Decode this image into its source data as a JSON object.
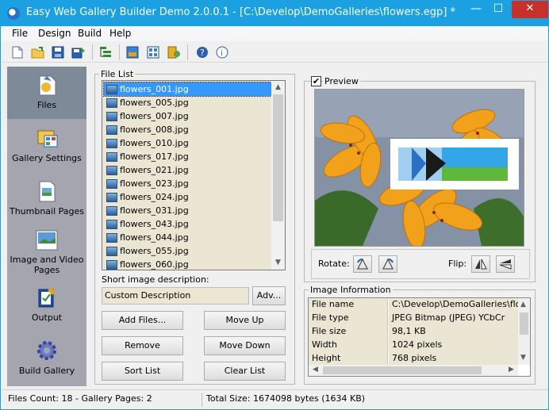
{
  "window": {
    "title": "Easy Web Gallery Builder Demo 2.0.0.1 - [C:\\Develop\\DemoGalleries\\flowers.egp] *"
  },
  "menu": [
    "File",
    "Design",
    "Build",
    "Help"
  ],
  "toolbar_icons": [
    "new-icon",
    "open-icon",
    "save-icon",
    "save-as-icon",
    "add-files-icon",
    "image-view-icon",
    "thumbnail-view-icon",
    "build-icon",
    "help-icon",
    "about-icon"
  ],
  "sidebar": {
    "items": [
      {
        "label": "Files",
        "icon": "files-icon",
        "active": true
      },
      {
        "label": "Gallery Settings",
        "icon": "gallery-settings-icon"
      },
      {
        "label": "Thumbnail Pages",
        "icon": "thumbnail-pages-icon"
      },
      {
        "label": "Image and Video Pages",
        "icon": "image-video-pages-icon"
      },
      {
        "label": "Output",
        "icon": "output-icon"
      },
      {
        "label": "Build Gallery",
        "icon": "build-gallery-icon"
      }
    ]
  },
  "file_list": {
    "label": "File List",
    "files": [
      "flowers_001.jpg",
      "flowers_005.jpg",
      "flowers_007.jpg",
      "flowers_008.jpg",
      "flowers_010.jpg",
      "flowers_017.jpg",
      "flowers_021.jpg",
      "flowers_023.jpg",
      "flowers_024.jpg",
      "flowers_031.jpg",
      "flowers_043.jpg",
      "flowers_044.jpg",
      "flowers_055.jpg",
      "flowers_060.jpg"
    ],
    "selected_index": 0,
    "scroll_position": 0
  },
  "description": {
    "label": "Short image description:",
    "value": "Custom Description",
    "adv_label": "Adv..."
  },
  "buttons": {
    "add_files": "Add Files...",
    "move_up": "Move Up",
    "remove": "Remove",
    "move_down": "Move Down",
    "sort_list": "Sort List",
    "clear_list": "Clear List"
  },
  "preview": {
    "label": "Preview",
    "checked": true,
    "check_mark": "✔"
  },
  "rotate": {
    "rotate_label": "Rotate:",
    "flip_label": "Flip:"
  },
  "image_info": {
    "label": "Image Information",
    "rows": [
      {
        "key": "File name",
        "value": "C:\\Develop\\DemoGalleries\\flow..."
      },
      {
        "key": "File type",
        "value": "JPEG Bitmap (JPEG) YCbCr"
      },
      {
        "key": "File size",
        "value": "98,1 KB"
      },
      {
        "key": "Width",
        "value": "1024 pixels"
      },
      {
        "key": "Height",
        "value": "768 pixels"
      }
    ]
  },
  "status": {
    "left": "Files Count: 18 - Gallery Pages: 2",
    "right": "Total Size: 1674098 bytes (1634 KB)"
  },
  "colors": {
    "title_bar": "#1ba1e2",
    "selection": "#3399ff",
    "sidebar": "#a5a5af",
    "list_bg": "#ebe6d4"
  }
}
